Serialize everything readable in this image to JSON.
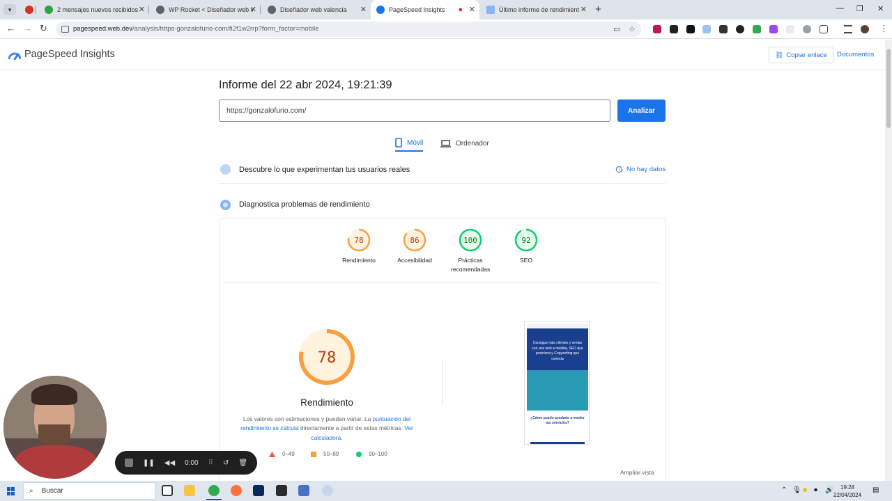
{
  "browser": {
    "tabs": [
      {
        "title": "2 mensajes nuevos recibidos",
        "fav": "#2fa24a"
      },
      {
        "title": "WP Rocket < Diseñador web v",
        "fav": "#5f6368"
      },
      {
        "title": "Diseñador web valencia",
        "fav": "#5f6368"
      },
      {
        "title": "PageSpeed Insights",
        "fav": "#1a73e8"
      },
      {
        "title": "Último informe de rendimient",
        "fav": "#8ab4f8"
      }
    ],
    "url_host": "pagespeed.web.dev",
    "url_path": "/analysis/https-gonzalofurio-com/fi2f1w2rrp?form_factor=mobile"
  },
  "header": {
    "title": "PageSpeed Insights",
    "copy_link": "Copiar enlace",
    "docs": "Documentos"
  },
  "report": {
    "title": "Informe del 22 abr 2024, 19:21:39",
    "url_value": "https://gonzalofurio.com/",
    "analyze": "Analizar",
    "tab_mobile": "Móvil",
    "tab_desktop": "Ordenador",
    "real_users": "Descubre lo que experimentan tus usuarios reales",
    "no_data": "No hay datos",
    "diagnose": "Diagnostica problemas de rendimiento"
  },
  "scores": [
    {
      "label": "Rendimiento",
      "value": 78,
      "color": "#fa9f3f"
    },
    {
      "label": "Accesibilidad",
      "value": 86,
      "color": "#fa9f3f"
    },
    {
      "label": "Prácticas recomendadas",
      "value": 100,
      "color": "#0cce6b"
    },
    {
      "label": "SEO",
      "value": 92,
      "color": "#0cce6b"
    }
  ],
  "performance": {
    "score": 78,
    "label": "Rendimiento",
    "explain_1": "Los valores son estimaciones y pueden variar. La ",
    "explain_link_1": "puntuación del rendimiento se calcula",
    "explain_2": " directamente a partir de estas métricas. ",
    "explain_link_2": "Ver calculadora.",
    "legend": [
      "0–49",
      "50–89",
      "90–100"
    ],
    "expand": "Ampliar vista"
  },
  "phone_preview": {
    "hero_text": "Consigue más clientes y ventas con una web a medida, SEO que posiciona y Copywriting que conecta",
    "question": "¿Cómo puedo ayudarte a vender tus servicios?"
  },
  "recorder": {
    "time": "0:00"
  },
  "taskbar": {
    "search": "Buscar",
    "time": "19:28",
    "date": "22/04/2024"
  },
  "colors": {
    "accent": "#1a73e8",
    "average": "#fa9f3f",
    "pass": "#0cce6b",
    "fail": "#ff4e42"
  }
}
